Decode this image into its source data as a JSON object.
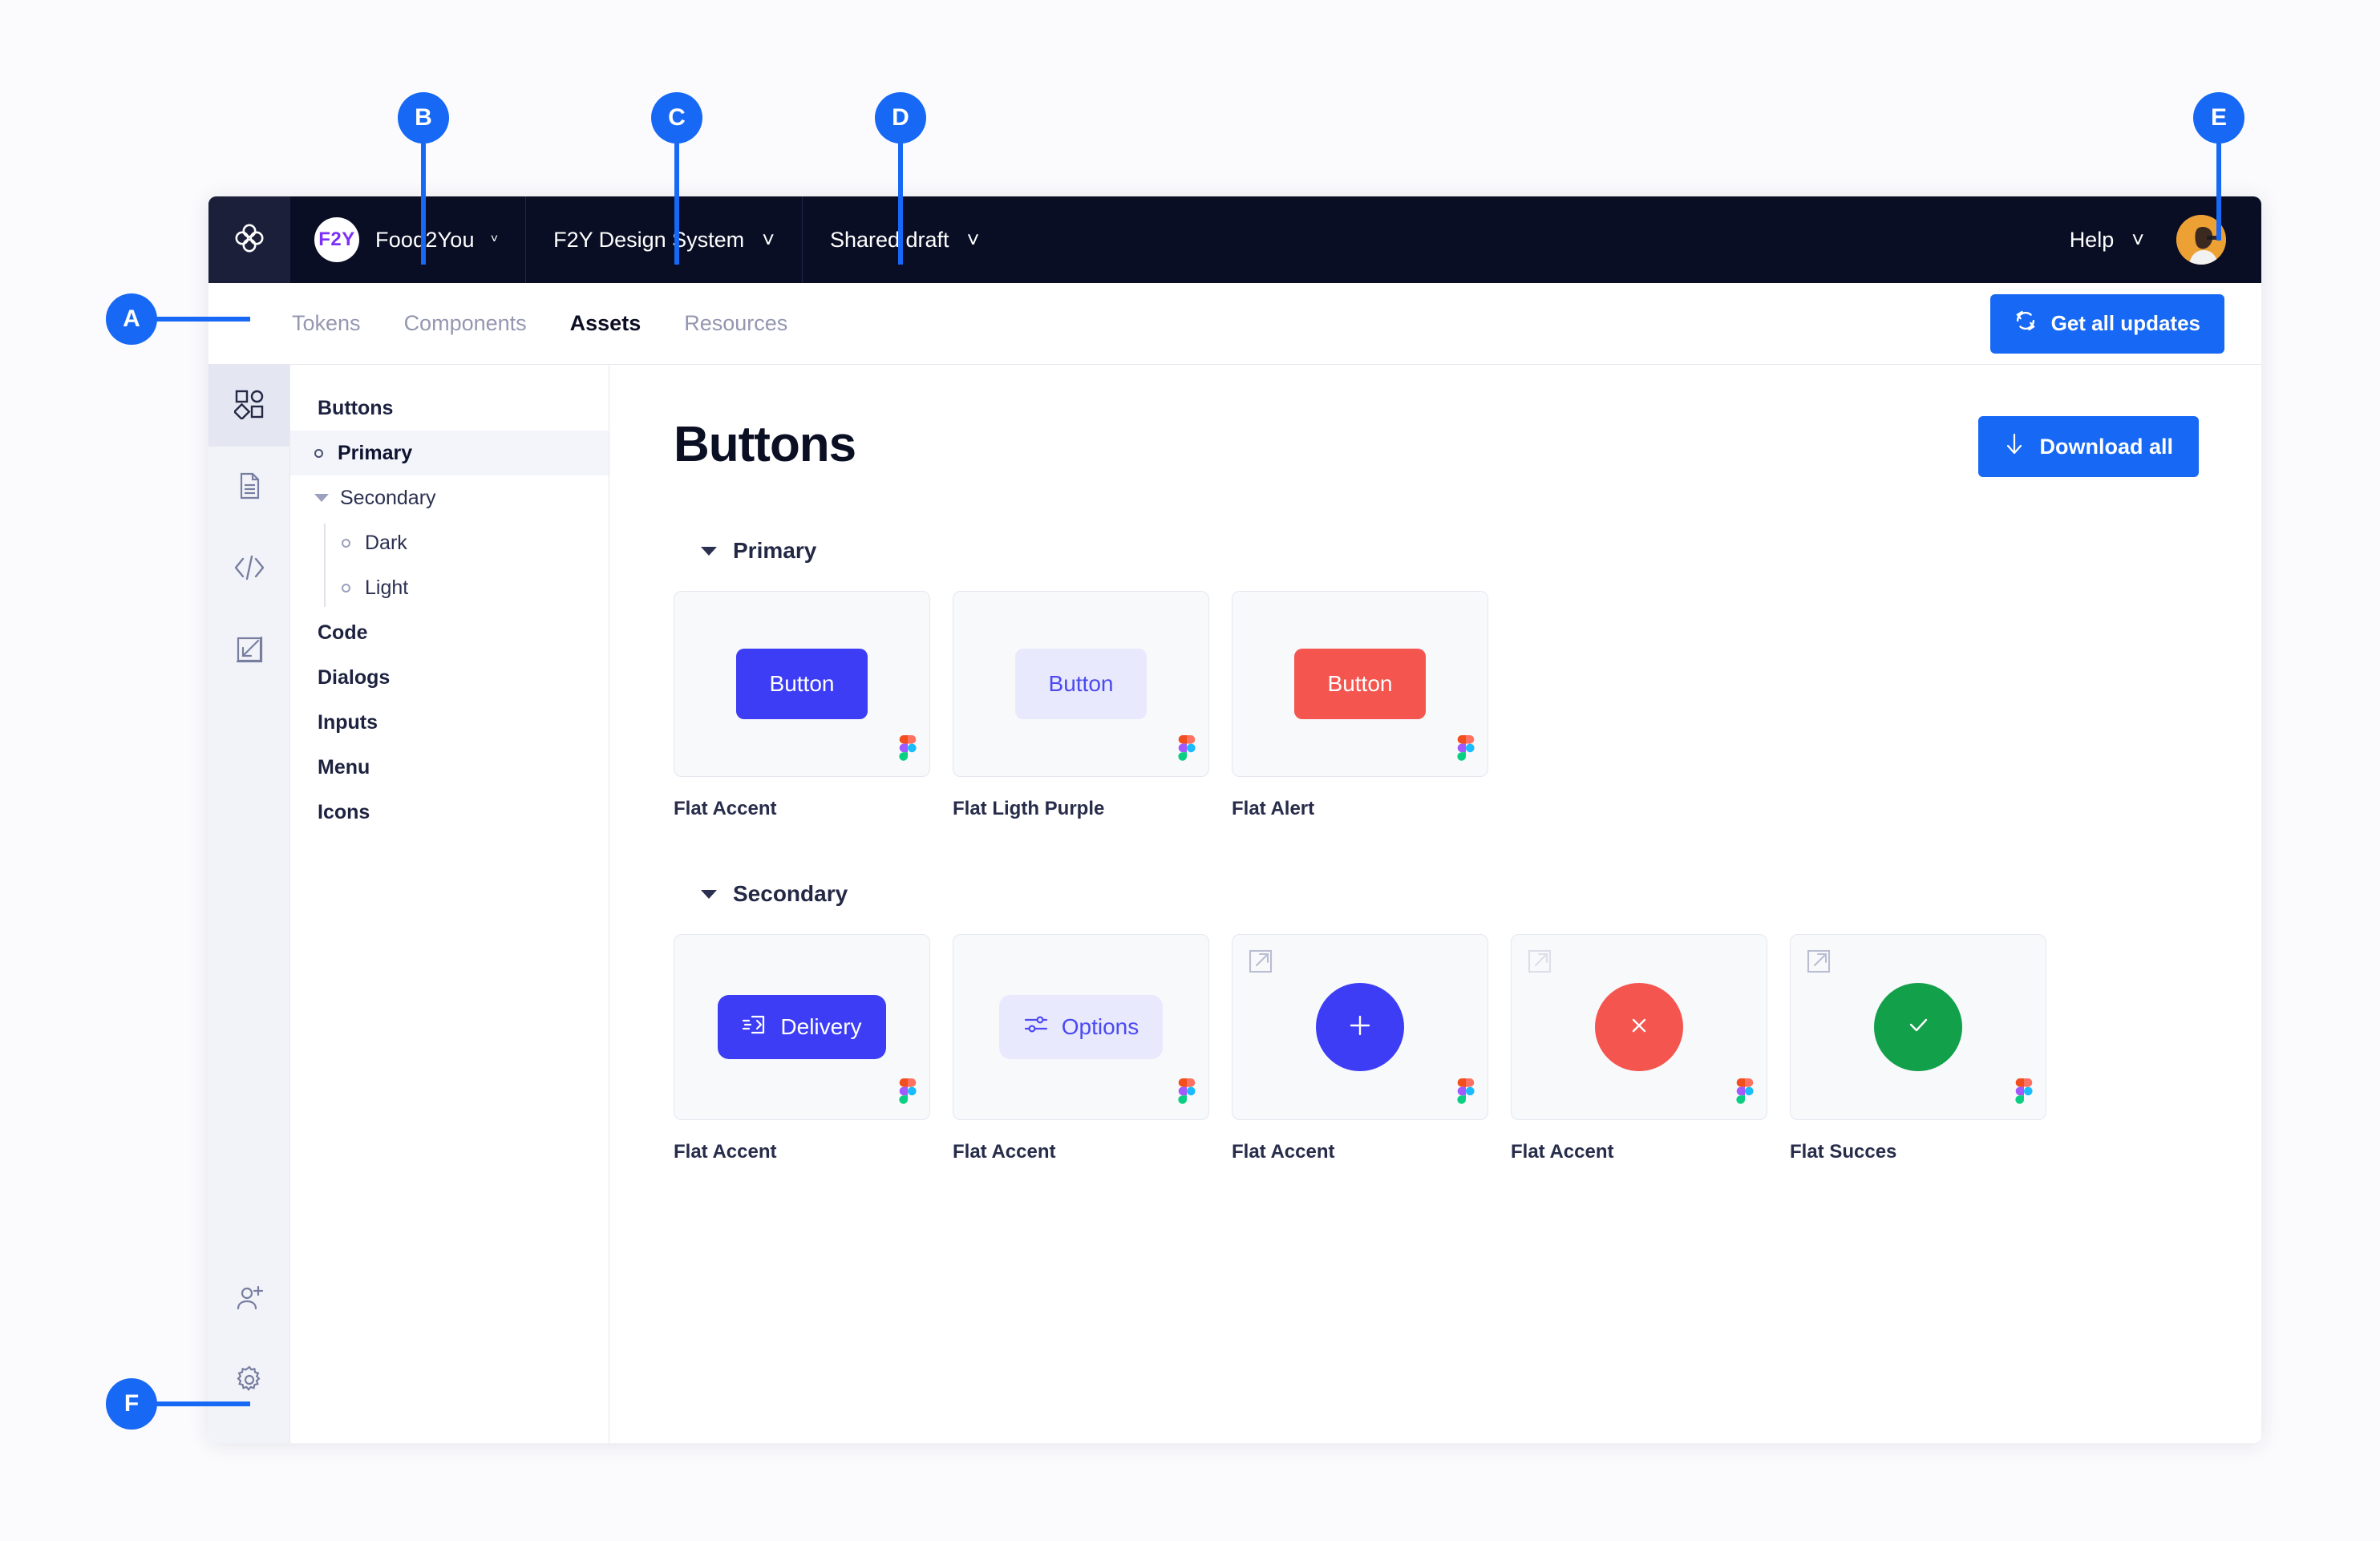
{
  "app": {
    "logo_icon": "app-loop-logo",
    "brand": {
      "initials": "F2Y",
      "name": "Food2You",
      "chevron": "˅"
    },
    "project_menu": {
      "label": "F2Y Design System",
      "chevron": "˅"
    },
    "status_menu": {
      "label": "Shared draft",
      "chevron": "˅"
    },
    "help_menu": {
      "label": "Help",
      "chevron": "˅"
    },
    "avatar": "user-photo-avatar"
  },
  "tabs": {
    "items": [
      {
        "label": "Tokens",
        "active": false
      },
      {
        "label": "Components",
        "active": false
      },
      {
        "label": "Assets",
        "active": true
      },
      {
        "label": "Resources",
        "active": false
      }
    ],
    "updates_button": {
      "label": "Get all updates",
      "icon": "refresh-icon"
    }
  },
  "rail": {
    "top_items": [
      {
        "name": "components",
        "icon": "shapes-icon",
        "active": true
      },
      {
        "name": "documentation",
        "icon": "document-icon",
        "active": false
      },
      {
        "name": "code",
        "icon": "code-icon",
        "active": false
      },
      {
        "name": "import",
        "icon": "import-arrow-icon",
        "active": false
      }
    ],
    "bottom_items": [
      {
        "name": "invite-member",
        "icon": "add-user-icon",
        "active": false
      },
      {
        "name": "settings",
        "icon": "gear-icon",
        "active": true
      }
    ]
  },
  "sidebar": {
    "items": [
      {
        "label": "Buttons",
        "type": "group",
        "selected": false
      },
      {
        "label": "Primary",
        "type": "child",
        "selected": true,
        "marker": "bullet"
      },
      {
        "label": "Secondary",
        "type": "child",
        "selected": false,
        "marker": "caret"
      },
      {
        "label": "Dark",
        "type": "grand",
        "selected": false,
        "marker": "bullet"
      },
      {
        "label": "Light",
        "type": "grand",
        "selected": false,
        "marker": "bullet"
      },
      {
        "label": "Code",
        "type": "group",
        "selected": false
      },
      {
        "label": "Dialogs",
        "type": "group",
        "selected": false
      },
      {
        "label": "Inputs",
        "type": "group",
        "selected": false
      },
      {
        "label": "Menu",
        "type": "group",
        "selected": false
      },
      {
        "label": "Icons",
        "type": "group",
        "selected": false
      }
    ]
  },
  "main": {
    "title": "Buttons",
    "download_button": {
      "label": "Download all",
      "icon": "download-arrow-icon"
    },
    "sections": [
      {
        "title": "Primary",
        "cards": [
          {
            "label": "Flat Accent",
            "style": "db-accent",
            "text": "Button",
            "icon": null,
            "shape": "rect",
            "ext": false
          },
          {
            "label": "Flat Ligth Purple",
            "style": "db-lightpurple",
            "text": "Button",
            "icon": null,
            "shape": "rect",
            "ext": false
          },
          {
            "label": "Flat Alert",
            "style": "db-alert",
            "text": "Button",
            "icon": null,
            "shape": "rect",
            "ext": false
          }
        ]
      },
      {
        "title": "Secondary",
        "cards": [
          {
            "label": "Flat Accent",
            "style": "db-pill-accent",
            "text": "Delivery",
            "icon": "delivery-box-icon",
            "shape": "pill",
            "ext": false
          },
          {
            "label": "Flat Accent",
            "style": "db-pill-light",
            "text": "Options",
            "icon": "sliders-icon",
            "shape": "pill",
            "ext": false
          },
          {
            "label": "Flat Accent",
            "style": "accent",
            "text": "",
            "icon": "plus-icon",
            "shape": "circle",
            "ext": true
          },
          {
            "label": "Flat Accent",
            "style": "alert",
            "text": "",
            "icon": "close-x-icon",
            "shape": "circle",
            "ext": true
          },
          {
            "label": "Flat Succes",
            "style": "success",
            "text": "",
            "icon": "check-icon",
            "shape": "circle",
            "ext": true
          }
        ]
      }
    ]
  },
  "callouts": [
    {
      "letter": "A"
    },
    {
      "letter": "B"
    },
    {
      "letter": "C"
    },
    {
      "letter": "D"
    },
    {
      "letter": "E"
    },
    {
      "letter": "F"
    }
  ],
  "colors": {
    "accent_blue": "#1668f5",
    "button_accent": "#3d3df5",
    "alert_red": "#f4554f",
    "success_green": "#13a04a",
    "light_purple": "#e8e9fd",
    "topbar_dark": "#0a0e25",
    "brand_purple": "#7b2ff7"
  }
}
